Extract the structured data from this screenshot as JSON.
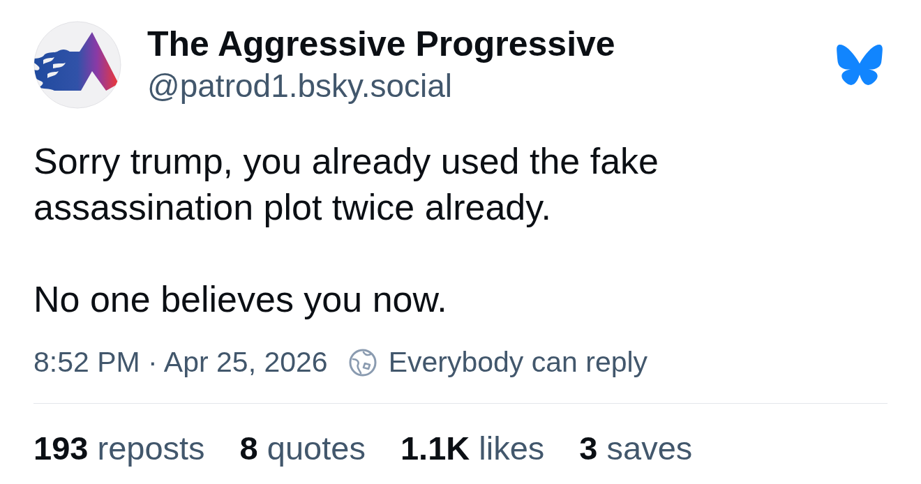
{
  "post": {
    "author": {
      "display_name": "The Aggressive Progressive",
      "handle": "@patrod1.bsky.social"
    },
    "body": [
      "Sorry trump, you already used the fake assassination plot twice already.",
      "No one believes you now."
    ],
    "timestamp": "8:52 PM · Apr 25, 2026",
    "reply_setting": "Everybody can reply",
    "stats": [
      {
        "text": "**193** reposts"
      },
      {
        "text": "**8** quotes"
      },
      {
        "text": "**1.1K** likes"
      },
      {
        "text": "**3** saves"
      }
    ]
  }
}
